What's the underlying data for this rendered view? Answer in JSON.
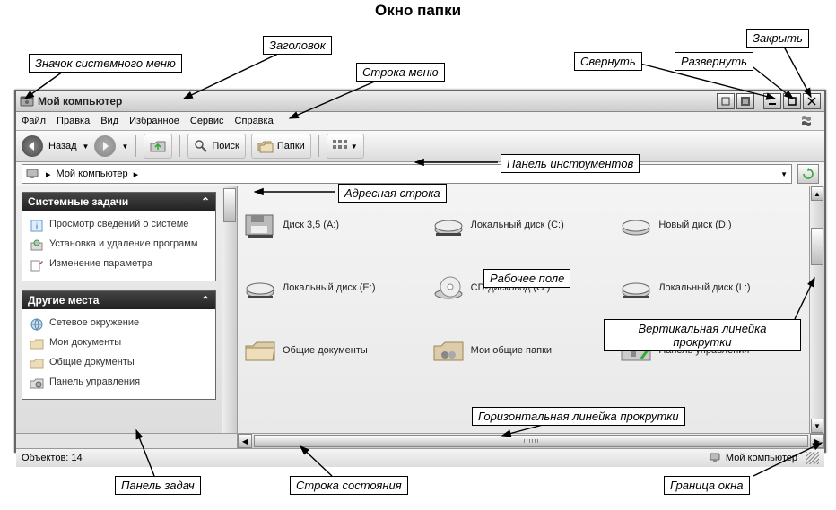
{
  "diagram": {
    "title": "Окно папки"
  },
  "callouts": {
    "sysmenu_icon": "Значок системного меню",
    "titlebar": "Заголовок",
    "menubar": "Строка меню",
    "minimize": "Свернуть",
    "maximize": "Развернуть",
    "close": "Закрыть",
    "toolbar": "Панель инструментов",
    "address": "Адресная строка",
    "workarea": "Рабочее поле",
    "vscroll": "Вертикальная линейка прокрутки",
    "hscroll": "Горизонтальная линейка прокрутки",
    "taskpanel": "Панель задач",
    "statusbar": "Строка состояния",
    "border": "Граница окна"
  },
  "window": {
    "title": "Мой компьютер",
    "menu": [
      "Файл",
      "Правка",
      "Вид",
      "Избранное",
      "Сервис",
      "Справка"
    ],
    "toolbar": {
      "back": "Назад",
      "search": "Поиск",
      "folders": "Папки"
    },
    "address": {
      "path": "Мой компьютер",
      "sep": "▸"
    },
    "sidebar": {
      "system": {
        "header": "Системные задачи",
        "items": [
          "Просмотр сведений о системе",
          "Установка и удаление программ",
          "Изменение параметра"
        ]
      },
      "places": {
        "header": "Другие места",
        "items": [
          "Сетевое окружение",
          "Мои документы",
          "Общие документы",
          "Панель управления"
        ]
      }
    },
    "items": [
      {
        "label": "Диск 3,5 (A:)",
        "icon": "floppy"
      },
      {
        "label": "Локальный диск (C:)",
        "icon": "hdd"
      },
      {
        "label": "Новый диск (D:)",
        "icon": "hdd"
      },
      {
        "label": "Локальный диск (E:)",
        "icon": "hdd"
      },
      {
        "label": "CD-дисковод (G:)",
        "icon": "cd"
      },
      {
        "label": "Локальный диск (L:)",
        "icon": "hdd"
      },
      {
        "label": "Общие документы",
        "icon": "folder"
      },
      {
        "label": "Мои общие папки",
        "icon": "userfolder"
      },
      {
        "label": "Панель управления",
        "icon": "cpanel"
      }
    ],
    "status": {
      "left": "Объектов: 14",
      "right": "Мой компьютер"
    }
  }
}
